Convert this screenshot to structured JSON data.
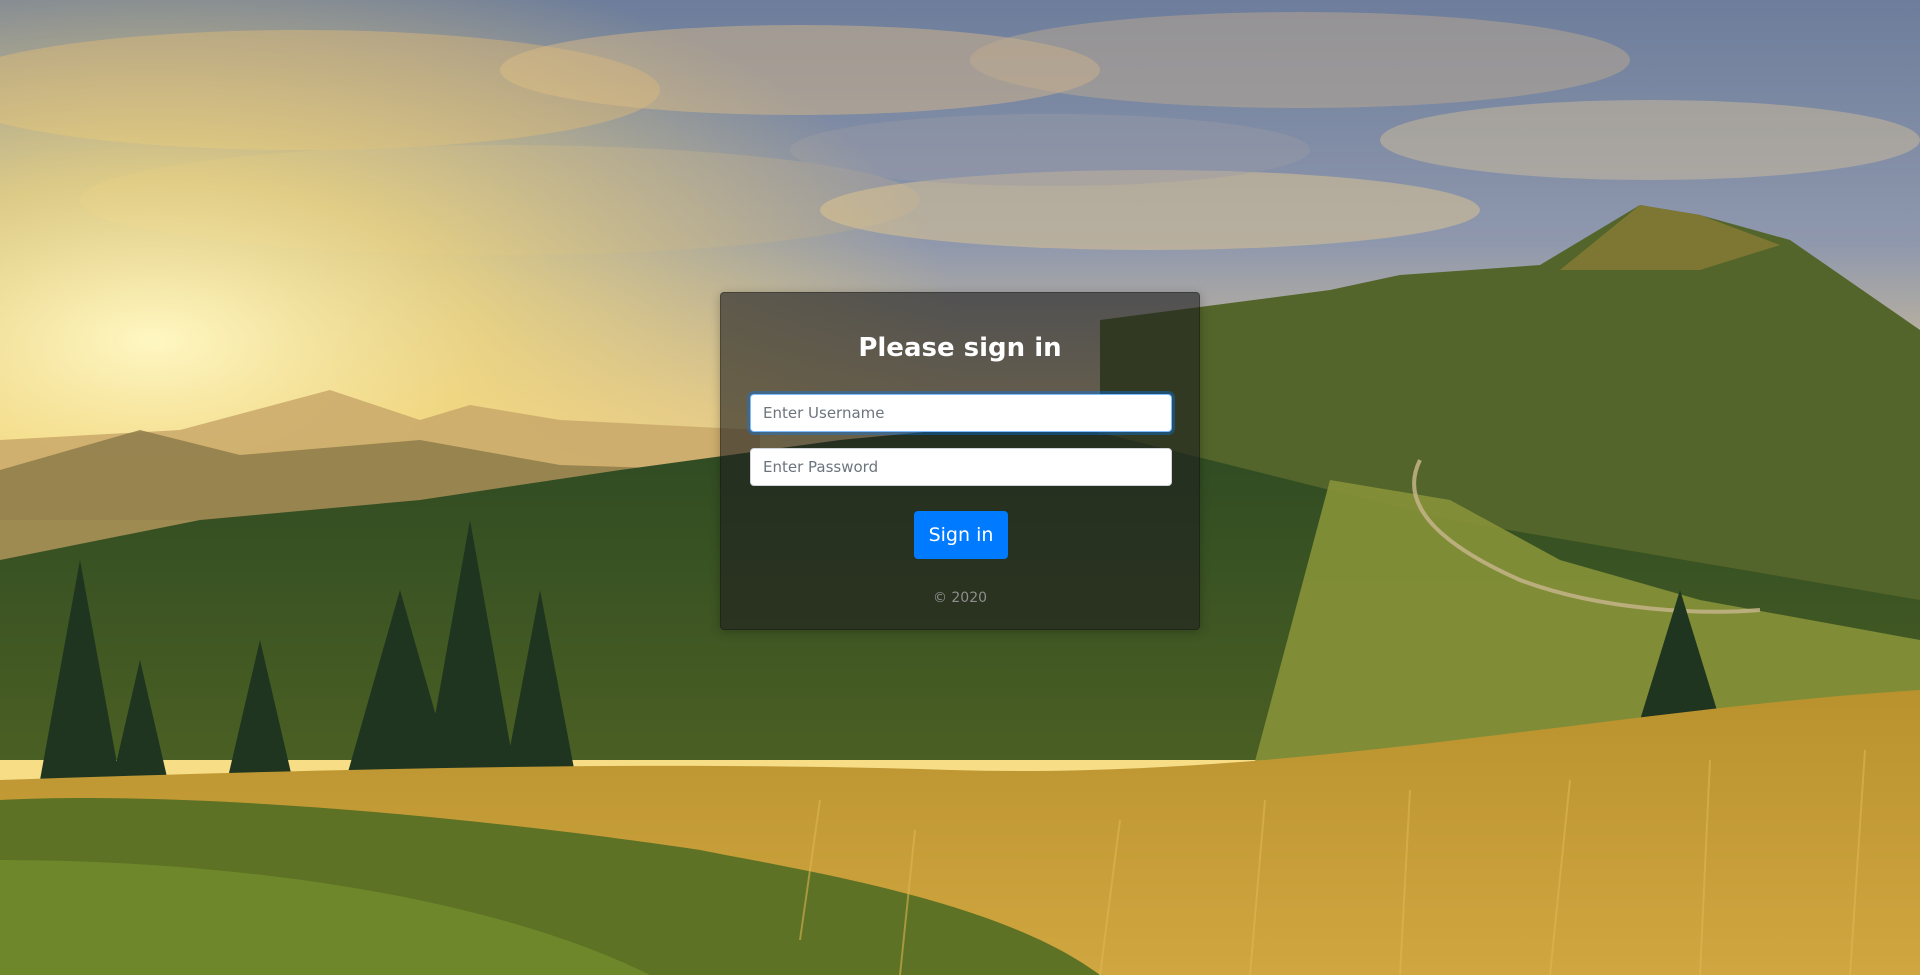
{
  "signin": {
    "title": "Please sign in",
    "username": {
      "value": "",
      "placeholder": "Enter Username"
    },
    "password": {
      "value": "",
      "placeholder": "Enter Password"
    },
    "button_label": "Sign in",
    "copyright": "© 2020"
  },
  "colors": {
    "primary_button": "#007bff",
    "card_overlay": "rgba(30,30,30,0.62)",
    "title_text": "#ffffff",
    "copyright_text": "#8e8e8e"
  },
  "background": {
    "subject": "mountain-landscape-photo"
  }
}
